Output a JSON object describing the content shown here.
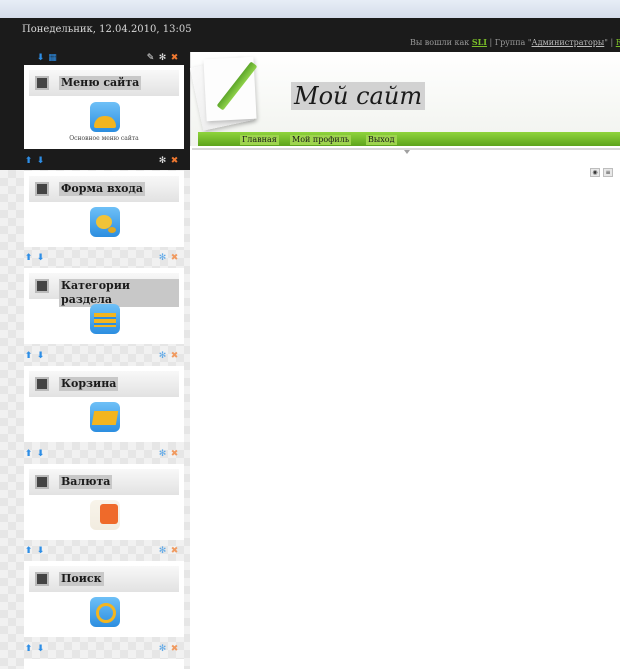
{
  "header": {
    "date": "Понедельник, 12.04.2010, 13:05",
    "login_prefix": "Вы вошли как",
    "user": "SLI",
    "group_prefix": " | Группа \"",
    "group": "Администраторы",
    "group_suffix": "\" | ",
    "next_link": "R"
  },
  "site": {
    "title": "Мой сайт",
    "nav": [
      "Главная",
      "Мой профиль",
      "Выход"
    ]
  },
  "modules": [
    {
      "title": "Меню сайта",
      "caption": "Основное меню сайта",
      "icon": "menu-bell-icon"
    },
    {
      "title": "Форма входа",
      "caption": "",
      "icon": "key-icon"
    },
    {
      "title": "Категории раздела",
      "caption": "",
      "icon": "categories-icon"
    },
    {
      "title": "Корзина",
      "caption": "",
      "icon": "basket-icon"
    },
    {
      "title": "Валюта",
      "caption": "",
      "icon": "currency-icon"
    },
    {
      "title": "Поиск",
      "caption": "",
      "icon": "search-magnifier-icon"
    }
  ],
  "icons": {
    "toolbar_view": "preview-icon",
    "toolbar_edit": "edit-icon"
  },
  "colors": {
    "accent_green": "#6cb32a",
    "dark_band": "#1b1b1b",
    "control_blue": "#2d8ee6",
    "control_orange": "#f07830"
  }
}
